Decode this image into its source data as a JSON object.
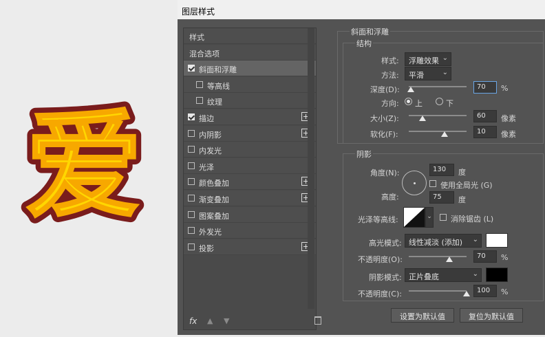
{
  "window": {
    "title": "图层样式"
  },
  "preview": {
    "glyph": "爱",
    "fill_color": "#ffd700",
    "outline_color": "#7a1c1c"
  },
  "styles_panel": {
    "items": [
      {
        "label": "样式",
        "has_checkbox": false,
        "checked": false,
        "has_plus": false,
        "selected": false,
        "indent": false
      },
      {
        "label": "混合选项",
        "has_checkbox": false,
        "checked": false,
        "has_plus": false,
        "selected": false,
        "indent": false
      },
      {
        "label": "斜面和浮雕",
        "has_checkbox": true,
        "checked": true,
        "has_plus": false,
        "selected": true,
        "indent": false
      },
      {
        "label": "等高线",
        "has_checkbox": true,
        "checked": false,
        "has_plus": false,
        "selected": false,
        "indent": true
      },
      {
        "label": "纹理",
        "has_checkbox": true,
        "checked": false,
        "has_plus": false,
        "selected": false,
        "indent": true
      },
      {
        "label": "描边",
        "has_checkbox": true,
        "checked": true,
        "has_plus": true,
        "selected": false,
        "indent": false
      },
      {
        "label": "内阴影",
        "has_checkbox": true,
        "checked": false,
        "has_plus": true,
        "selected": false,
        "indent": false
      },
      {
        "label": "内发光",
        "has_checkbox": true,
        "checked": false,
        "has_plus": false,
        "selected": false,
        "indent": false
      },
      {
        "label": "光泽",
        "has_checkbox": true,
        "checked": false,
        "has_plus": false,
        "selected": false,
        "indent": false
      },
      {
        "label": "颜色叠加",
        "has_checkbox": true,
        "checked": false,
        "has_plus": true,
        "selected": false,
        "indent": false
      },
      {
        "label": "渐变叠加",
        "has_checkbox": true,
        "checked": false,
        "has_plus": true,
        "selected": false,
        "indent": false
      },
      {
        "label": "图案叠加",
        "has_checkbox": true,
        "checked": false,
        "has_plus": false,
        "selected": false,
        "indent": false
      },
      {
        "label": "外发光",
        "has_checkbox": true,
        "checked": false,
        "has_plus": false,
        "selected": false,
        "indent": false
      },
      {
        "label": "投影",
        "has_checkbox": true,
        "checked": false,
        "has_plus": true,
        "selected": false,
        "indent": false
      }
    ],
    "fx_label": "fx"
  },
  "bevel": {
    "section_title": "斜面和浮雕",
    "structure_title": "结构",
    "style_label": "样式:",
    "style_value": "浮雕效果",
    "technique_label": "方法:",
    "technique_value": "平滑",
    "depth_label": "深度(D):",
    "depth_value": "70",
    "depth_unit": "%",
    "depth_level": 0.03,
    "direction_label": "方向:",
    "direction_up": "上",
    "direction_down": "下",
    "size_label": "大小(Z):",
    "size_value": "60",
    "size_unit": "像素",
    "size_level": 0.24,
    "soften_label": "软化(F):",
    "soften_value": "10",
    "soften_unit": "像素",
    "soften_level": 0.62
  },
  "shading": {
    "title": "阴影",
    "angle_label": "角度(N):",
    "angle_value": "130",
    "angle_unit": "度",
    "global_light_label": "使用全局光 (G)",
    "altitude_label": "高度:",
    "altitude_value": "75",
    "altitude_unit": "度",
    "gloss_contour_label": "光泽等高线:",
    "antialias_label": "消除锯齿 (L)",
    "highlight_mode_label": "高光模式:",
    "highlight_mode_value": "线性减淡 (添加)",
    "highlight_color": "#ffffff",
    "highlight_opacity_label": "不透明度(O):",
    "highlight_opacity_value": "70",
    "highlight_opacity_unit": "%",
    "highlight_opacity_level": 0.7,
    "shadow_mode_label": "阴影模式:",
    "shadow_mode_value": "正片叠底",
    "shadow_color": "#000000",
    "shadow_opacity_label": "不透明度(C):",
    "shadow_opacity_value": "100",
    "shadow_opacity_unit": "%",
    "shadow_opacity_level": 1.0
  },
  "buttons": {
    "make_default": "设置为默认值",
    "reset_default": "复位为默认值"
  }
}
